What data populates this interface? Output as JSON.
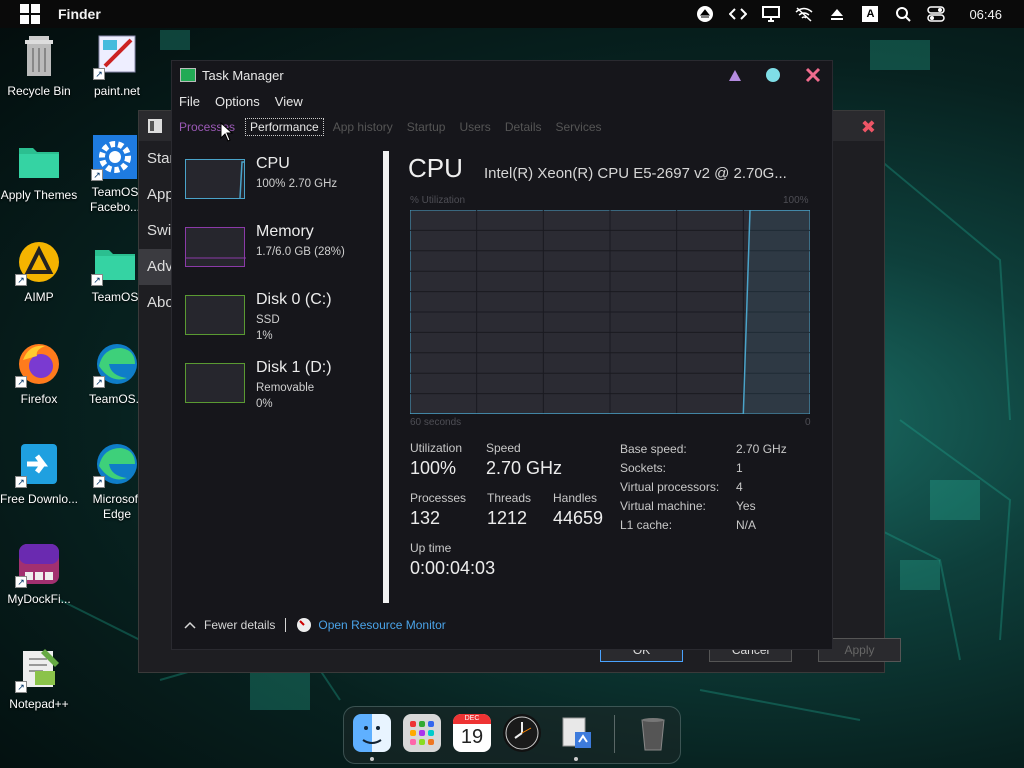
{
  "menubar": {
    "app_name": "Finder",
    "clock": "06:46",
    "tray_icons": [
      "eject-icon",
      "code-icon",
      "display-icon",
      "network-off-icon",
      "upload-icon",
      "input-language-icon",
      "search-icon",
      "control-center-icon"
    ],
    "input_lang": "A"
  },
  "desktop": {
    "icons": [
      {
        "name": "recycle-bin",
        "label": "Recycle Bin",
        "icon": "trash-icon"
      },
      {
        "name": "paint-net",
        "label": "paint.net",
        "icon": "paint-icon"
      },
      {
        "name": "apply-themes",
        "label": "Apply Themes",
        "icon": "folder-icon"
      },
      {
        "name": "teamos-facebook",
        "label": "TeamOS Facebo...",
        "icon": "gear-icon"
      },
      {
        "name": "aimp",
        "label": "AIMP",
        "icon": "aimp-icon"
      },
      {
        "name": "teamos-folder",
        "label": "TeamOS",
        "icon": "folder-icon"
      },
      {
        "name": "firefox",
        "label": "Firefox",
        "icon": "firefox-icon"
      },
      {
        "name": "teamos-x",
        "label": "TeamOS.x",
        "icon": "edge-icon"
      },
      {
        "name": "free-download",
        "label": "Free Downlo...",
        "icon": "download-icon"
      },
      {
        "name": "microsoft-edge",
        "label": "Microsoft Edge",
        "icon": "edge-icon"
      },
      {
        "name": "mydockfinder",
        "label": "MyDockFi...",
        "icon": "dock-app-icon"
      },
      {
        "name": "notepad-plus",
        "label": "Notepad++",
        "icon": "notepad-icon"
      }
    ]
  },
  "bg_window": {
    "side_items": [
      "Star",
      "App",
      "Swi",
      "Adv",
      "Abo"
    ],
    "buttons": {
      "ok": "OK",
      "cancel": "Cancel",
      "apply": "Apply"
    }
  },
  "task_manager": {
    "title": "Task Manager",
    "menu": [
      "File",
      "Options",
      "View"
    ],
    "tabs": [
      "Processes",
      "Performance",
      "App history",
      "Startup",
      "Users",
      "Details",
      "Services"
    ],
    "resources": [
      {
        "name": "CPU",
        "sub1": "100%  2.70 GHz",
        "sub2": ""
      },
      {
        "name": "Memory",
        "sub1": "1.7/6.0 GB (28%)",
        "sub2": ""
      },
      {
        "name": "Disk 0 (C:)",
        "sub1": "SSD",
        "sub2": "1%"
      },
      {
        "name": "Disk 1 (D:)",
        "sub1": "Removable",
        "sub2": "0%"
      }
    ],
    "header": "CPU",
    "cpu_model": "Intel(R) Xeon(R) CPU E5-2697 v2 @ 2.70G...",
    "util_label": "% Utilization",
    "util_max": "100%",
    "seconds_label": "60 seconds",
    "seconds_zero": "0",
    "stats": {
      "utilization_label": "Utilization",
      "utilization": "100%",
      "speed_label": "Speed",
      "speed": "2.70 GHz",
      "processes_label": "Processes",
      "processes": "132",
      "threads_label": "Threads",
      "threads": "1212",
      "handles_label": "Handles",
      "handles": "44659",
      "uptime_label": "Up time",
      "uptime": "0:00:04:03"
    },
    "details": [
      {
        "k": "Base speed:",
        "v": "2.70 GHz"
      },
      {
        "k": "Sockets:",
        "v": "1"
      },
      {
        "k": "Virtual processors:",
        "v": "4"
      },
      {
        "k": "Virtual machine:",
        "v": "Yes"
      },
      {
        "k": "L1 cache:",
        "v": "N/A"
      }
    ],
    "footer": {
      "fewer": "Fewer details",
      "resource_monitor": "Open Resource Monitor"
    }
  },
  "chart_data": {
    "type": "line",
    "x": [
      60,
      10,
      9,
      0
    ],
    "values": [
      0,
      0,
      100,
      100
    ],
    "ylim": [
      0,
      100
    ],
    "xlim": [
      60,
      0
    ],
    "color": "#4aa3c9"
  },
  "dock": {
    "items": [
      "finder-icon",
      "launchpad-icon",
      "calendar-icon",
      "clock-icon",
      "preview-icon",
      "trash-icon"
    ],
    "calendar_day": "19",
    "calendar_month": "DEC"
  }
}
